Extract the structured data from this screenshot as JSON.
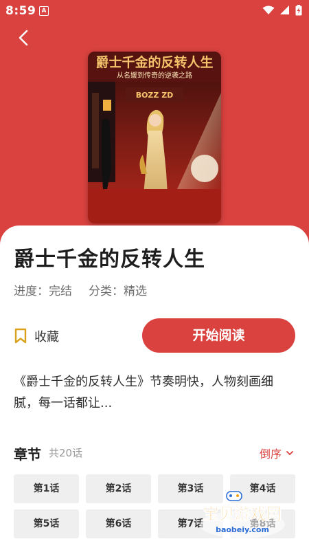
{
  "status": {
    "time": "8:59",
    "notification_icon": "A"
  },
  "nav": {
    "back_icon": "back-arrow-icon"
  },
  "cover": {
    "title": "爵士千金的反转人生",
    "subtitle": "从名媛到传奇的逆袭之路",
    "sign_text": "BOZZ ZD"
  },
  "book": {
    "title": "爵士千金的反转人生",
    "progress_label": "进度：",
    "progress_value": "完结",
    "category_label": "分类：",
    "category_value": "精选"
  },
  "actions": {
    "favorite_label": "收藏",
    "read_label": "开始阅读"
  },
  "description": "《爵士千金的反转人生》节奏明快，人物刻画细腻，每一话都让...",
  "chapters": {
    "heading": "章节",
    "count": "共20话",
    "sort_label": "倒序",
    "items": [
      "第1话",
      "第2话",
      "第3话",
      "第4话",
      "第5话",
      "第6话",
      "第7话",
      "第8话"
    ]
  },
  "watermark": {
    "text": "宝贝游戏网",
    "domain": "baobeiy.com"
  },
  "colors": {
    "accent": "#d9423f",
    "chip_bg": "#efefef"
  }
}
